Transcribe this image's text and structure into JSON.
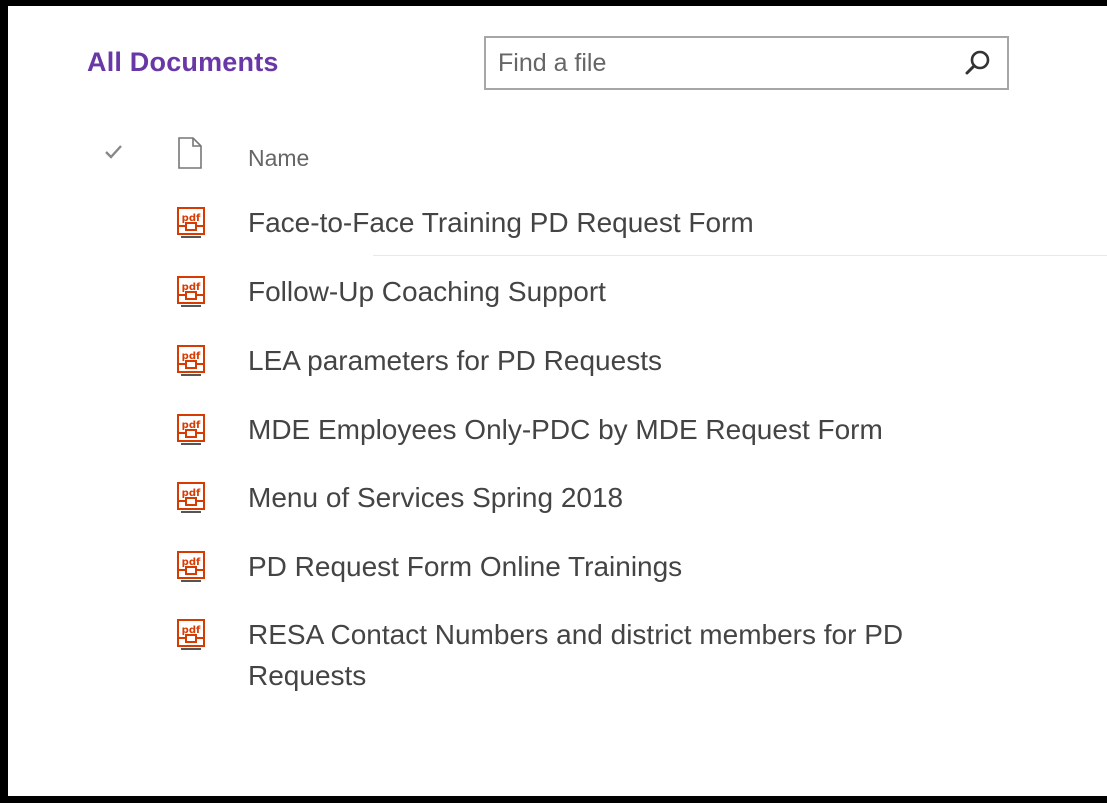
{
  "view": {
    "title": "All Documents"
  },
  "search": {
    "placeholder": "Find a file"
  },
  "list": {
    "name_header": "Name",
    "items": [
      {
        "name": "Face-to-Face Training PD Request Form",
        "type_icon": "pdf-icon"
      },
      {
        "name": "Follow-Up Coaching Support",
        "type_icon": "pdf-icon"
      },
      {
        "name": "LEA parameters for PD Requests",
        "type_icon": "pdf-icon"
      },
      {
        "name": "MDE Employees Only-PDC by MDE Request Form",
        "type_icon": "pdf-icon"
      },
      {
        "name": "Menu of Services Spring 2018",
        "type_icon": "pdf-icon"
      },
      {
        "name": "PD Request Form Online Trainings",
        "type_icon": "pdf-icon"
      },
      {
        "name": "RESA Contact Numbers and district members for PD Requests",
        "type_icon": "pdf-icon"
      }
    ]
  },
  "colors": {
    "accent": "#6a37a6",
    "pdf": "#d83b01",
    "text": "#444444",
    "muted": "#666666"
  }
}
